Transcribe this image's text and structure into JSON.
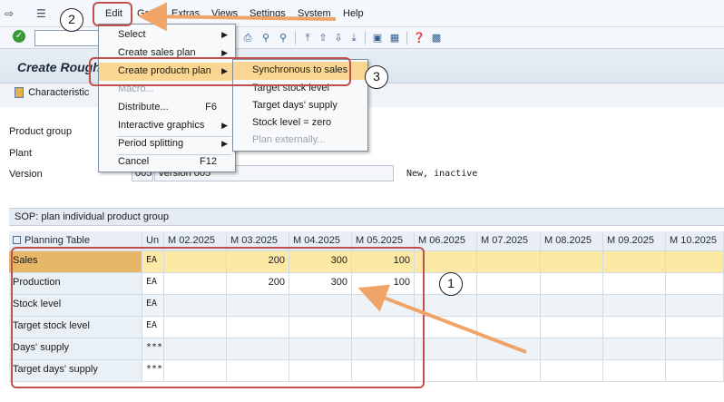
{
  "menubar": {
    "items": [
      {
        "label": "Edit",
        "acc": "E"
      },
      {
        "label": "Goto",
        "acc": "G"
      },
      {
        "label": "Extras",
        "acc": "x"
      },
      {
        "label": "Views",
        "acc": "V"
      },
      {
        "label": "Settings",
        "acc": "S"
      },
      {
        "label": "System",
        "acc": "y"
      },
      {
        "label": "Help",
        "acc": "H"
      }
    ]
  },
  "header": {
    "title": "Create Rough",
    "characteristic_label": "Characteristic",
    "fields": {
      "product_group_label": "Product group",
      "plant_label": "Plant",
      "version_label": "Version",
      "version_value": "005",
      "version_desc": "Version 005",
      "status": "New, inactive"
    }
  },
  "section_title": "SOP: plan individual product group",
  "table": {
    "columns": [
      "Planning Table",
      "Un",
      "M 02.2025",
      "M 03.2025",
      "M 04.2025",
      "M 05.2025",
      "M 06.2025",
      "M 07.2025",
      "M 08.2025",
      "M 09.2025",
      "M 10.2025"
    ],
    "rows": [
      {
        "label": "Sales",
        "unit": "EA",
        "values": [
          "",
          "200",
          "300",
          "100",
          "",
          "",
          "",
          "",
          ""
        ]
      },
      {
        "label": "Production",
        "unit": "EA",
        "values": [
          "",
          "200",
          "300",
          "100",
          "",
          "",
          "",
          "",
          ""
        ]
      },
      {
        "label": "Stock level",
        "unit": "EA",
        "values": [
          "",
          "",
          "",
          "",
          "",
          "",
          "",
          "",
          ""
        ]
      },
      {
        "label": "Target stock level",
        "unit": "EA",
        "values": [
          "",
          "",
          "",
          "",
          "",
          "",
          "",
          "",
          ""
        ]
      },
      {
        "label": "Days' supply",
        "unit": "***",
        "values": [
          "",
          "",
          "",
          "",
          "",
          "",
          "",
          "",
          ""
        ]
      },
      {
        "label": "Target days' supply",
        "unit": "***",
        "values": [
          "",
          "",
          "",
          "",
          "",
          "",
          "",
          "",
          ""
        ]
      }
    ]
  },
  "edit_menu": {
    "items": [
      {
        "label": "Select",
        "submenu": true,
        "disabled": false
      },
      {
        "label": "Create sales plan",
        "submenu": true,
        "disabled": false
      },
      {
        "label": "Create productn plan",
        "submenu": true,
        "disabled": false,
        "highlighted": true
      },
      {
        "label": "Macro...",
        "disabled": true
      },
      {
        "label": "Distribute...",
        "shortcut": "F6",
        "disabled": false
      },
      {
        "label": "Interactive graphics",
        "submenu": true,
        "disabled": false
      },
      {
        "label": "Period splitting",
        "submenu": true,
        "disabled": false
      },
      {
        "label": "Cancel",
        "shortcut": "F12",
        "disabled": false
      }
    ]
  },
  "submenu": {
    "items": [
      {
        "label": "Synchronous to sales",
        "highlighted": true,
        "disabled": false
      },
      {
        "label": "Target stock level",
        "disabled": false
      },
      {
        "label": "Target days' supply",
        "disabled": false
      },
      {
        "label": "Stock level = zero",
        "disabled": false
      },
      {
        "label": "Plan externally...",
        "disabled": true
      }
    ]
  },
  "annotations": {
    "step1": "1",
    "step2": "2",
    "step3": "3"
  },
  "colors": {
    "annotation": "#c0504d",
    "arrow": "#f0a468",
    "highlight": "#f9d691",
    "selected_row": "#fde9a6"
  }
}
